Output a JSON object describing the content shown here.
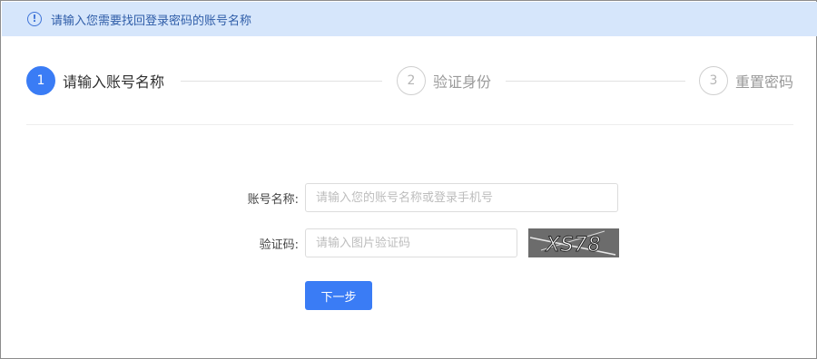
{
  "alert": {
    "message": "请输入您需要找回登录密码的账号名称",
    "icon": "info-circle-icon"
  },
  "steps": [
    {
      "number": "1",
      "label": "请输入账号名称",
      "active": true
    },
    {
      "number": "2",
      "label": "验证身份",
      "active": false
    },
    {
      "number": "3",
      "label": "重置密码",
      "active": false
    }
  ],
  "form": {
    "account": {
      "label": "账号名称:",
      "placeholder": "请输入您的账号名称或登录手机号",
      "value": ""
    },
    "captcha": {
      "label": "验证码:",
      "placeholder": "请输入图片验证码",
      "value": "",
      "image_text": "XS78"
    },
    "next_label": "下一步"
  },
  "colors": {
    "primary": "#3a7cf5",
    "alert_bg": "#d6e6fb",
    "alert_text": "#2f5da8",
    "inactive_step": "#b5b5b5"
  }
}
